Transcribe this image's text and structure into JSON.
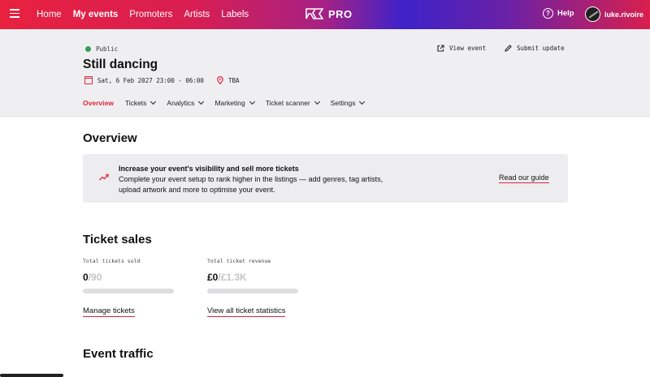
{
  "nav": {
    "links": [
      "Home",
      "My events",
      "Promoters",
      "Artists",
      "Labels"
    ],
    "active": "My events",
    "logo": "PRO",
    "help": "Help",
    "user": "luke.rivoire"
  },
  "event": {
    "visibility": "Public",
    "title": "Still dancing",
    "datetime": "Sat, 6 Feb 2027 23:00 - 06:00",
    "venue": "TBA",
    "view_label": "View event",
    "submit_label": "Submit update",
    "tabs": [
      {
        "label": "Overview",
        "dropdown": false
      },
      {
        "label": "Tickets",
        "dropdown": true
      },
      {
        "label": "Analytics",
        "dropdown": true
      },
      {
        "label": "Marketing",
        "dropdown": true
      },
      {
        "label": "Ticket scanner",
        "dropdown": true
      },
      {
        "label": "Settings",
        "dropdown": true
      }
    ]
  },
  "overview": {
    "heading": "Overview",
    "banner_title": "Increase your event's visibility and sell more tickets",
    "banner_text": "Complete your event setup to rank higher in the listings — add genres, tag artists, upload artwork and more to optimise your event.",
    "guide_link": "Read our guide"
  },
  "sales": {
    "heading": "Ticket sales",
    "sold_label": "Total tickets sold",
    "sold_value": "0",
    "sold_total": "/90",
    "sold_fraction": 0,
    "revenue_label": "Total ticket revenue",
    "revenue_value": "£0",
    "revenue_total": "/£1.3K",
    "revenue_fraction": 0,
    "manage_link": "Manage tickets",
    "stats_link": "View all ticket statistics"
  },
  "traffic": {
    "heading": "Event traffic"
  },
  "colors": {
    "accent": "#e0243c"
  }
}
